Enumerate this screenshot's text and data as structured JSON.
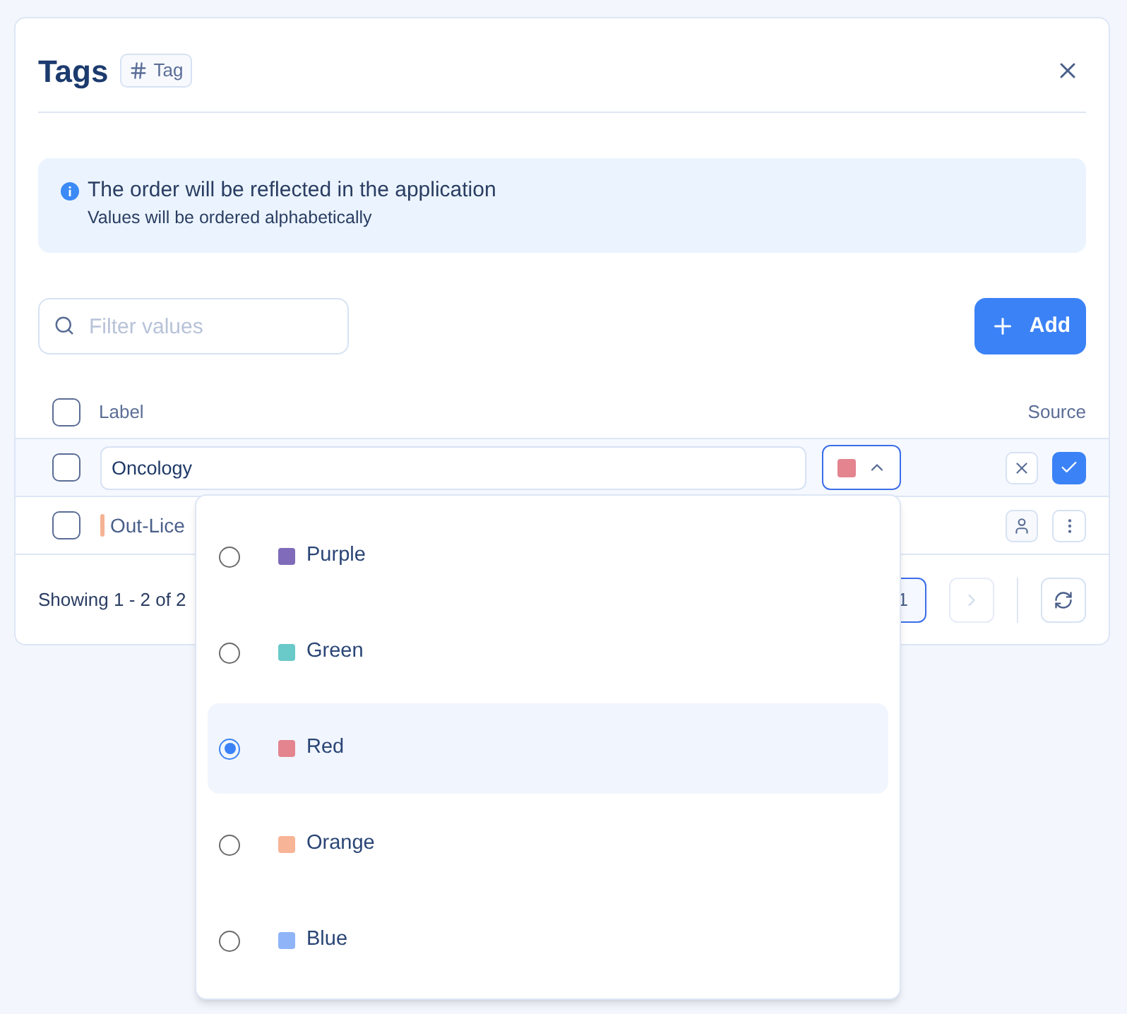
{
  "dialog": {
    "title": "Tags",
    "type_badge": "Tag"
  },
  "info": {
    "title": "The order will be reflected in the application",
    "subtitle": "Values will be ordered alphabetically"
  },
  "filter": {
    "placeholder": "Filter values"
  },
  "add_button": "Add",
  "table": {
    "select_all_checked": false,
    "columns": [
      "Label",
      "Source"
    ],
    "rows": [
      {
        "kind": "editing",
        "checked": false,
        "label": "Oncology",
        "color": "#e3848f",
        "picker_open": true
      },
      {
        "kind": "display",
        "checked": false,
        "label": "Out-Lice",
        "color": "#f5b394"
      }
    ]
  },
  "footer": {
    "summary": "Showing 1 - 2 of 2",
    "page": "1",
    "next_disabled": true
  },
  "color_options": [
    {
      "name": "Purple",
      "color": "#7f6bb9",
      "selected": false
    },
    {
      "name": "Green",
      "color": "#6ac9c9",
      "selected": false
    },
    {
      "name": "Red",
      "color": "#e3848f",
      "selected": true
    },
    {
      "name": "Orange",
      "color": "#f8b496",
      "selected": false
    },
    {
      "name": "Blue",
      "color": "#8fb5f8",
      "selected": false
    }
  ]
}
